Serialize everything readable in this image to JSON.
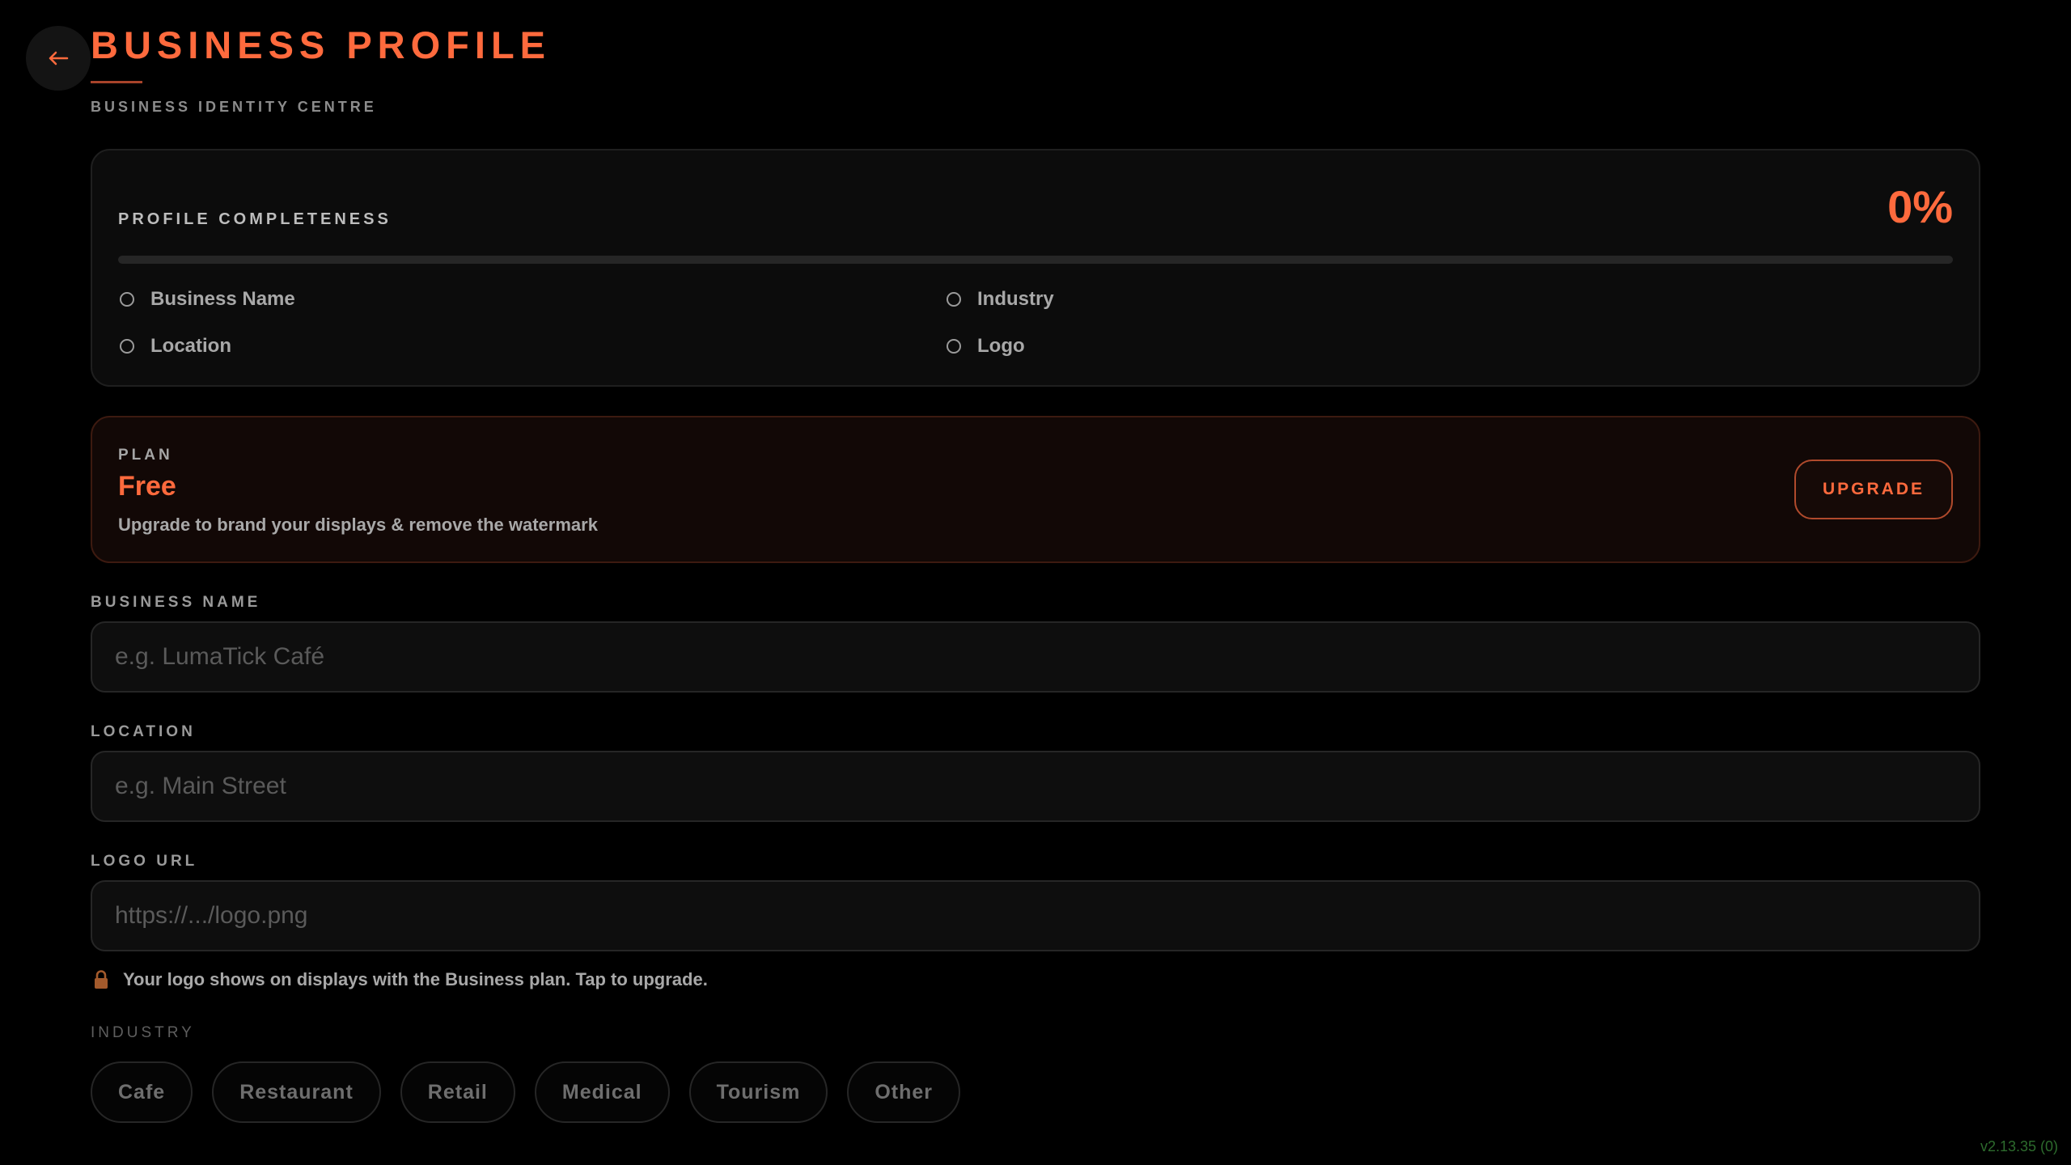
{
  "header": {
    "title": "BUSINESS PROFILE",
    "subtitle": "BUSINESS IDENTITY CENTRE",
    "back_icon": "arrow-left-icon"
  },
  "completeness": {
    "label": "PROFILE COMPLETENESS",
    "percent_text": "0%",
    "progress": 0,
    "items": [
      {
        "label": "Business Name",
        "done": false
      },
      {
        "label": "Industry",
        "done": false
      },
      {
        "label": "Location",
        "done": false
      },
      {
        "label": "Logo",
        "done": false
      }
    ]
  },
  "plan": {
    "label": "PLAN",
    "name": "Free",
    "description": "Upgrade to brand your displays & remove the watermark",
    "upgrade_label": "UPGRADE"
  },
  "form": {
    "business_name": {
      "label": "BUSINESS NAME",
      "value": "",
      "placeholder": "e.g. LumaTick Café"
    },
    "location": {
      "label": "LOCATION",
      "value": "",
      "placeholder": "e.g. Main Street"
    },
    "logo_url": {
      "label": "LOGO URL",
      "value": "",
      "placeholder": "https://.../logo.png"
    },
    "logo_note": "Your logo shows on displays with the Business plan. Tap to upgrade.",
    "logo_note_icon": "lock-icon"
  },
  "industry": {
    "label": "INDUSTRY",
    "options": [
      "Cafe",
      "Restaurant",
      "Retail",
      "Medical",
      "Tourism",
      "Other"
    ]
  },
  "version": "v2.13.35 (0)",
  "colors": {
    "accent": "#ff6a3d",
    "background": "#000000",
    "card": "#0c0c0c",
    "plan_card": "#120806"
  }
}
